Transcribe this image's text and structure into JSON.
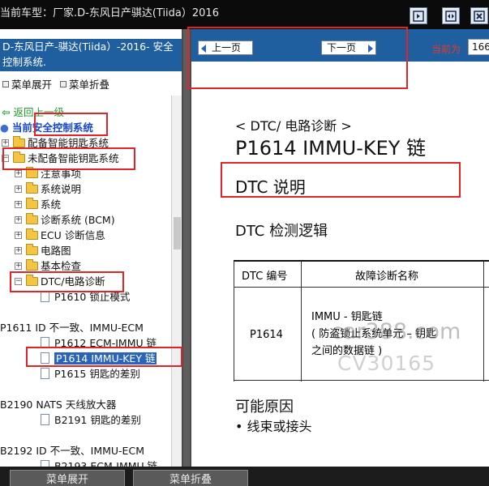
{
  "window": {
    "title": "当前车型：厂家.D-东风日产骐达(Tiida）2016",
    "icons": [
      "arrow-right-boxed-icon",
      "expand-horizontal-icon",
      "close-icon"
    ]
  },
  "left_pane": {
    "header": "D-东风日产-骐达(Tiida）-2016- 安全控制系统.",
    "menu_expand": "菜单展开",
    "menu_collapse": "菜单折叠",
    "back_link": "返回上一级",
    "current_prefix": "当前",
    "current_system": "安全控制系统",
    "tree": [
      {
        "label": "配备智能钥匙系统"
      },
      {
        "label": "未配备智能钥匙系统"
      },
      {
        "label": "注意事项"
      },
      {
        "label": "系统说明"
      },
      {
        "label": "系统"
      },
      {
        "label": "诊断系统 (BCM)"
      },
      {
        "label": "ECU 诊断信息"
      },
      {
        "label": "电路图"
      },
      {
        "label": "基本检查"
      },
      {
        "label": "DTC/电路诊断"
      },
      {
        "label": "P1610 锁止模式"
      },
      {
        "label": "P1611 ID 不一致、IMMU-ECM"
      },
      {
        "label": "P1612 ECM-IMMU 链"
      },
      {
        "label": "P1614 IMMU-KEY 链",
        "selected": true
      },
      {
        "label": "P1615 钥匙的差别"
      },
      {
        "label": "B2190 NATS 天线放大器"
      },
      {
        "label": "B2191 钥匙的差别"
      },
      {
        "label": "B2192 ID 不一致、IMMU-ECM"
      },
      {
        "label": "B2193 ECM-IMMU 链"
      }
    ]
  },
  "right_pane": {
    "prev_button": "上一页",
    "next_button": "下一页",
    "page_label": "当前为",
    "page_value": "166",
    "breadcrumb": "< DTC/ 电路诊断 >",
    "code_title": "P1614 IMMU-KEY 链",
    "dtc_desc_heading": "DTC 说明",
    "dtc_logic_heading": "DTC 检测逻辑",
    "table": {
      "headers": [
        "DTC 编号",
        "故障诊断名称"
      ],
      "row": {
        "code": "P1614",
        "name_lines": [
          "IMMU - 钥匙链",
          "( 防盗锁止系统单元 – 钥匙",
          "之间的数据链 )"
        ]
      }
    },
    "cause_heading": "可能原因",
    "cause_item": "• 线束或接头",
    "watermark_1": "car388.com",
    "watermark_2": "CV30165"
  },
  "bottom_bar": {
    "expand_button": "菜单展开",
    "collapse_button": "菜单折叠"
  }
}
